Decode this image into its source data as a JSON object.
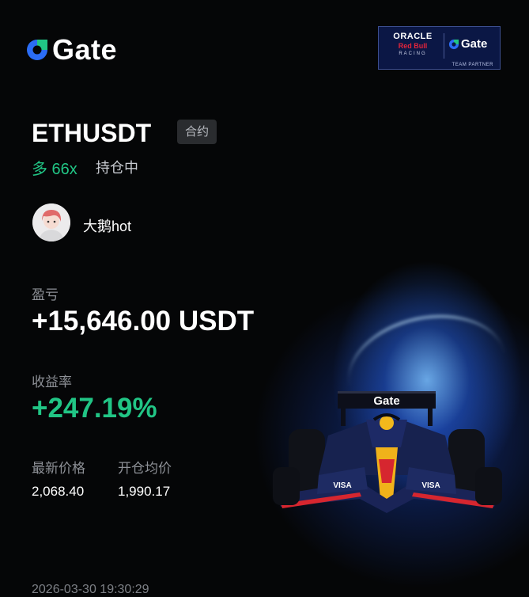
{
  "brand": {
    "name": "Gate",
    "accent": "#2b6df5"
  },
  "partner_badge": {
    "line1": "ORACLE",
    "line2": "Red Bull",
    "line3": "RACING",
    "brand": "Gate",
    "caption": "TEAM PARTNER"
  },
  "position": {
    "pair": "ETHUSDT",
    "type_tag": "合约",
    "side": "多 66x",
    "status": "持仓中"
  },
  "user": {
    "name": "大鹅hot"
  },
  "pnl": {
    "label": "盈亏",
    "value": "+15,646.00 USDT"
  },
  "roi": {
    "label": "收益率",
    "value": "+247.19%"
  },
  "prices": {
    "latest_label": "最新价格",
    "latest_value": "2,068.40",
    "entry_label": "开仓均价",
    "entry_value": "1,990.17"
  },
  "timestamp": "2026-03-30 19:30:29",
  "car_livery": {
    "wing_text": "Gate",
    "sidepod_text": "VISA"
  },
  "colors": {
    "positive": "#21c585",
    "background": "#050607"
  }
}
